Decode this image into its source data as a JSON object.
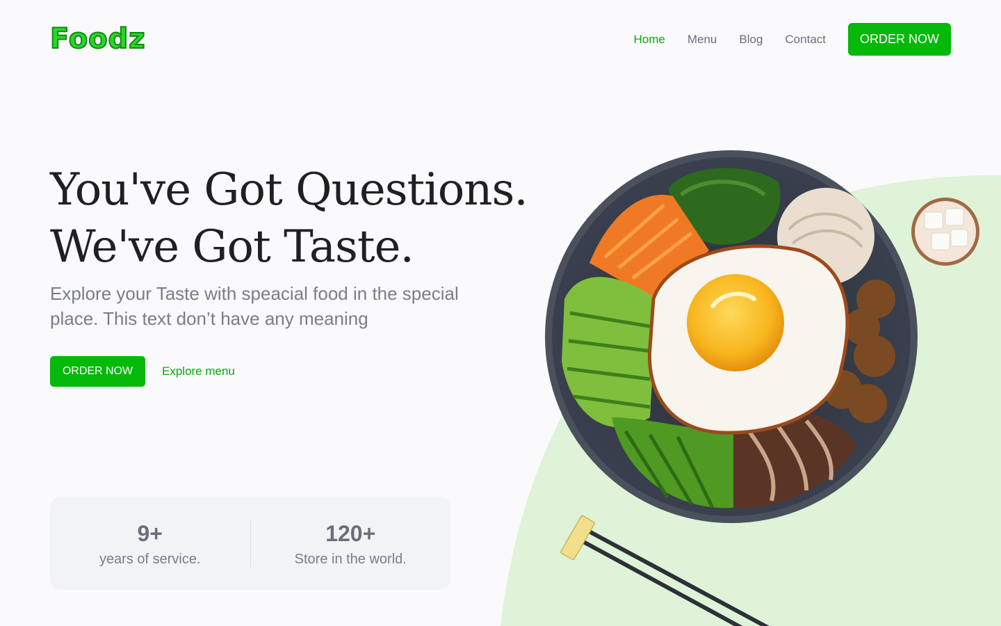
{
  "brand": {
    "logo_text": "Foodz",
    "accent": "#05b80a",
    "accent_light": "#def3d8"
  },
  "nav": {
    "items": [
      {
        "label": "Home",
        "active": true
      },
      {
        "label": "Menu",
        "active": false
      },
      {
        "label": "Blog",
        "active": false
      },
      {
        "label": "Contact",
        "active": false
      }
    ],
    "order_label": "ORDER NOW"
  },
  "hero": {
    "title_line1": "You've Got Questions.",
    "title_line2": "We've Got Taste.",
    "subtitle": "Explore your Taste with speacial food in the special place. This text don’t have any meaning",
    "order_label": "ORDER NOW",
    "explore_label": "Explore menu"
  },
  "stats": [
    {
      "value": "9+",
      "label": "years of service."
    },
    {
      "value": "120+",
      "label": "Store in the world."
    }
  ],
  "illustration": {
    "main": "bibimbap-bowl-icon",
    "side": "tofu-bowl-icon",
    "utensils": "chopsticks-icon"
  }
}
